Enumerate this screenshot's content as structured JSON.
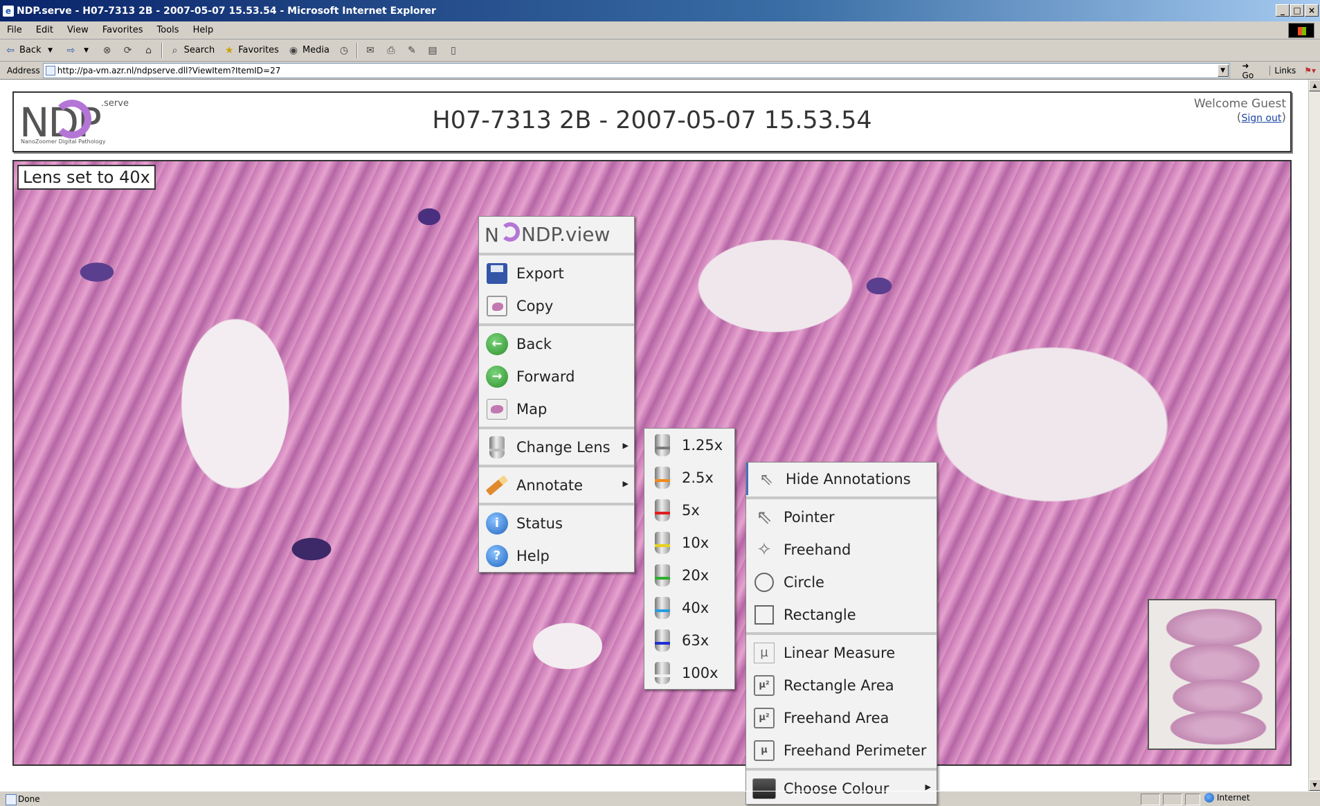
{
  "window": {
    "title": "NDP.serve - H07-7313 2B - 2007-05-07 15.53.54 - Microsoft Internet Explorer",
    "icon": "ie-icon",
    "controls": [
      "minimize-icon",
      "maximize-icon",
      "close-icon"
    ]
  },
  "menubar": {
    "items": [
      "File",
      "Edit",
      "View",
      "Favorites",
      "Tools",
      "Help"
    ]
  },
  "toolbar": {
    "back": "Back",
    "search": "Search",
    "favorites": "Favorites",
    "media": "Media"
  },
  "address": {
    "label": "Address",
    "url": "http://pa-vm.azr.nl/ndpserve.dll?ViewItem?ItemID=27",
    "go": "Go",
    "links": "Links"
  },
  "header": {
    "logo_text": "NDP",
    "logo_serve": ".serve",
    "logo_sub": "NanoZoomer Digital Pathology",
    "title": "H07-7313 2B - 2007-05-07 15.53.54",
    "welcome": "Welcome Guest",
    "sign_out": "Sign out"
  },
  "viewer": {
    "lens_note": "Lens set to 40x"
  },
  "context_menu": {
    "brand": "NDP.view",
    "items": {
      "export": "Export",
      "copy": "Copy",
      "back": "Back",
      "forward": "Forward",
      "map": "Map",
      "change_lens": "Change Lens",
      "annotate": "Annotate",
      "status": "Status",
      "help": "Help"
    }
  },
  "lens_menu": {
    "items": [
      {
        "label": "1.25x",
        "band": "#7a7a7a"
      },
      {
        "label": "2.5x",
        "band": "#f08a1c"
      },
      {
        "label": "5x",
        "band": "#e01e1e"
      },
      {
        "label": "10x",
        "band": "#e8d21a"
      },
      {
        "label": "20x",
        "band": "#2fae2f"
      },
      {
        "label": "40x",
        "band": "#2a9be0"
      },
      {
        "label": "63x",
        "band": "#1c2fd0"
      },
      {
        "label": "100x",
        "band": "#f0f0f0"
      }
    ]
  },
  "annotate_menu": {
    "hide": "Hide Annotations",
    "pointer": "Pointer",
    "freehand": "Freehand",
    "circle": "Circle",
    "rectangle": "Rectangle",
    "linear_measure": "Linear Measure",
    "rectangle_area": "Rectangle Area",
    "freehand_area": "Freehand Area",
    "freehand_perimeter": "Freehand Perimeter",
    "choose_colour": "Choose Colour",
    "mu_symbol": "µ",
    "mu2_symbol": "µ²"
  },
  "statusbar": {
    "text": "Done",
    "zone": "Internet"
  }
}
